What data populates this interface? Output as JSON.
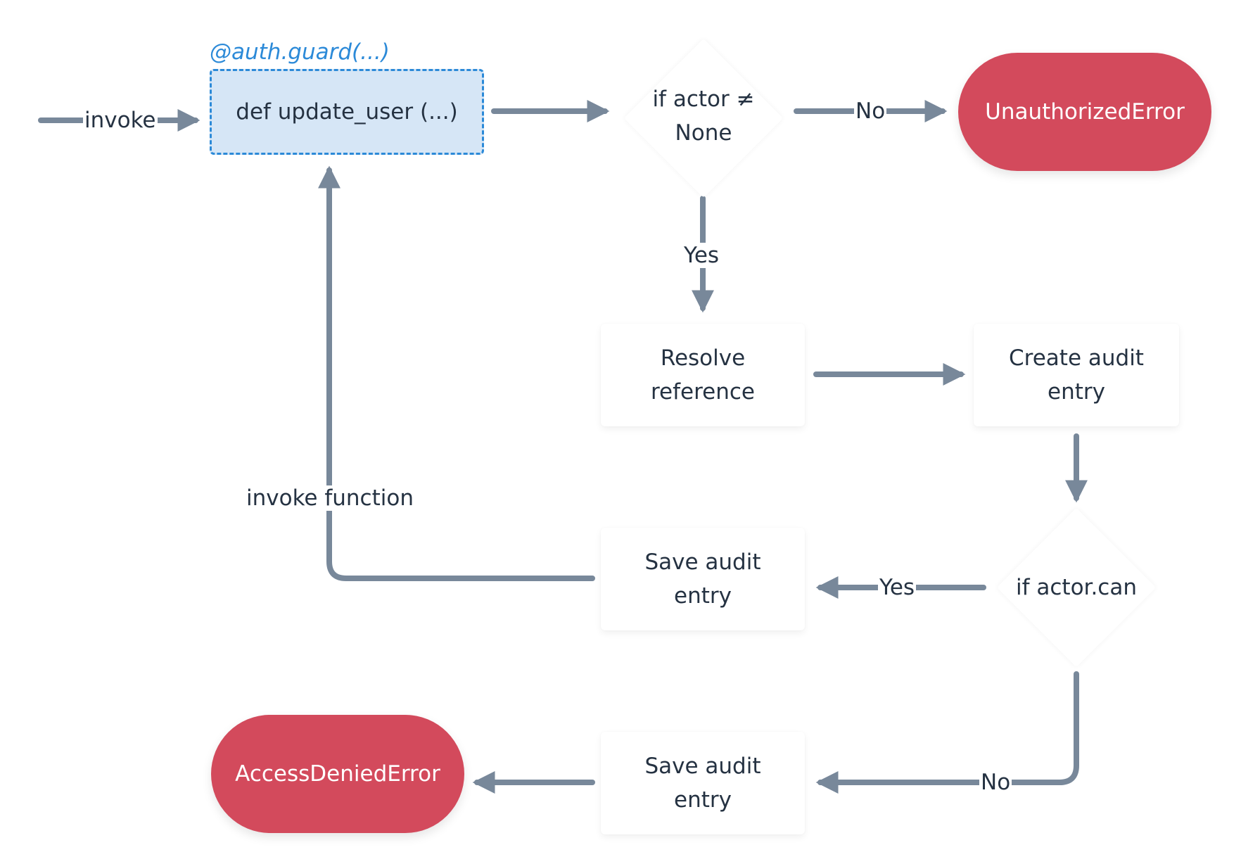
{
  "diagram": {
    "decorator_label": "@auth.guard(...)",
    "colors": {
      "arrow": "#78889a",
      "text": "#253242",
      "error_fill": "#d34a5c",
      "decorator_blue": "#2c8ad8",
      "function_fill": "#d6e6f6"
    },
    "nodes": {
      "func": "def update_user (...)",
      "check_actor_1": "if actor ≠",
      "check_actor_2": "None",
      "unauthorized": "UnauthorizedError",
      "resolve_1": "Resolve",
      "resolve_2": "reference",
      "create_1": "Create audit",
      "create_2": "entry",
      "check_can": "if actor.can",
      "save_yes_1": "Save audit",
      "save_yes_2": "entry",
      "save_no_1": "Save audit",
      "save_no_2": "entry",
      "access_denied": "AccessDeniedError"
    },
    "edge_labels": {
      "invoke": "invoke",
      "no_1": "No",
      "yes_1": "Yes",
      "yes_2": "Yes",
      "no_2": "No",
      "invoke_function": "invoke function"
    }
  }
}
